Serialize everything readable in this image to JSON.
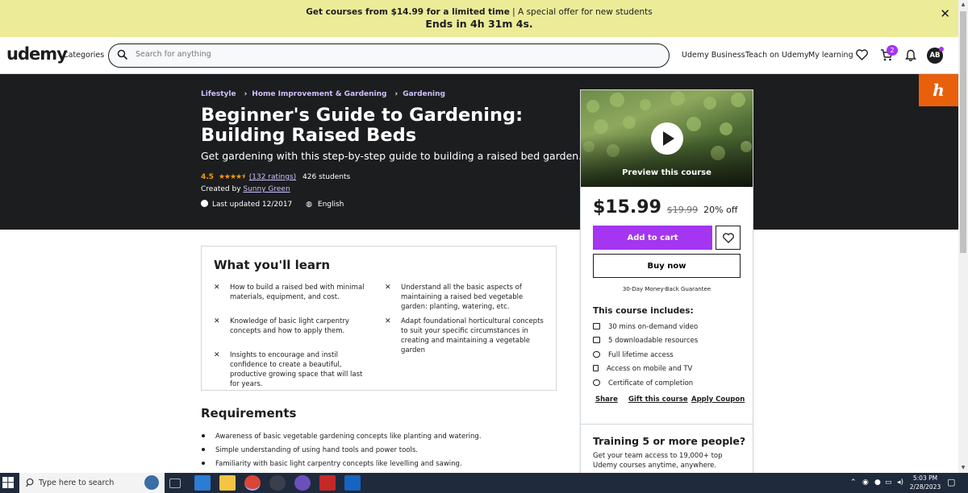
{
  "banner": {
    "line1_bold": "Get courses from $14.99 for a limited time",
    "line1_rest": " | A special offer for new students",
    "line2": "Ends in 4h 31m 4s."
  },
  "nav": {
    "logo": "udemy",
    "categories": "Categories",
    "search_placeholder": "Search for anything",
    "business": "Udemy Business",
    "teach": "Teach on Udemy",
    "learning": "My learning",
    "cart_count": "2",
    "avatar": "AB"
  },
  "breadcrumb": [
    "Lifestyle",
    "Home Improvement & Gardening",
    "Gardening"
  ],
  "course": {
    "title": "Beginner's Guide to Gardening: Building Raised Beds",
    "subtitle": "Get gardening with this step-by-step guide to building a raised bed garden.",
    "rating": "4.5",
    "rating_value": 4.5,
    "ratings_count": "(132 ratings)",
    "students": "426 students",
    "created_prefix": "Created by ",
    "author": "Sunny Green",
    "updated": "Last updated 12/2017",
    "language": "English"
  },
  "sidebar": {
    "preview_label": "Preview this course",
    "price": "$15.99",
    "old_price": "$19.99",
    "discount": "20% off",
    "add_to_cart": "Add to cart",
    "buy_now": "Buy now",
    "guarantee": "30-Day Money-Back Guarantee",
    "includes_title": "This course includes:",
    "includes": [
      "30 mins on-demand video",
      "5 downloadable resources",
      "Full lifetime access",
      "Access on mobile and TV",
      "Certificate of completion"
    ],
    "share": "Share",
    "gift": "Gift this course",
    "coupon": "Apply Coupon",
    "training_title": "Training 5 or more people?",
    "training_desc": "Get your team access to 19,000+ top Udemy courses anytime, anywhere."
  },
  "learn": {
    "title": "What you'll learn",
    "items": [
      "How to build a raised bed with minimal materials, equipment, and cost.",
      "Understand all the basic aspects of maintaining a raised bed vegetable garden: planting, watering, etc.",
      "Knowledge of basic light carpentry concepts and how to apply them.",
      "Adapt foundational horticultural concepts to suit your specific circumstances in creating and maintaining a vegetable garden",
      "Insights to encourage and instil confidence to create a beautiful, productive growing space that will last for years."
    ]
  },
  "requirements": {
    "title": "Requirements",
    "items": [
      "Awareness of basic vegetable gardening concepts like planting and watering.",
      "Simple understanding of using hand tools and power tools.",
      "Familiarity with basic light carpentry concepts like levelling and sawing."
    ]
  },
  "taskbar": {
    "search": "Type here to search",
    "time": "5:03 PM",
    "date": "2/28/2023"
  },
  "colors": {
    "accent": "#a435f0",
    "banner": "#eceb98",
    "hero": "#1c1d1f",
    "star": "#f69c08",
    "link_light": "#cec0fc"
  }
}
